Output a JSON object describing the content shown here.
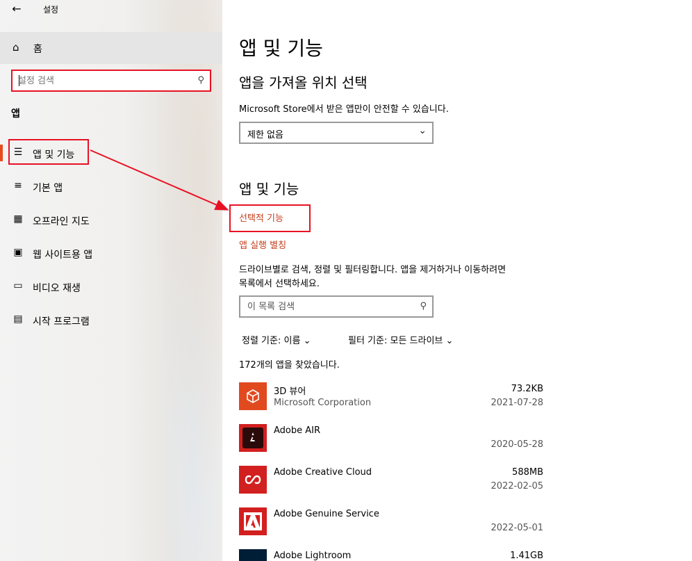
{
  "window": {
    "title": "설정"
  },
  "sidebar": {
    "home_label": "홈",
    "search_placeholder": "설정 검색",
    "section_label": "앱",
    "items": [
      {
        "label": "앱 및 기능"
      },
      {
        "label": "기본 앱"
      },
      {
        "label": "오프라인 지도"
      },
      {
        "label": "웹 사이트용 앱"
      },
      {
        "label": "비디오 재생"
      },
      {
        "label": "시작 프로그램"
      }
    ]
  },
  "main": {
    "page_title": "앱 및 기능",
    "source_heading": "앱을 가져올 위치 선택",
    "source_desc": "Microsoft Store에서 받은 앱만이 안전할 수 있습니다.",
    "source_value": "제한 없음",
    "apps_heading": "앱 및 기능",
    "optional_features_link": "선택적 기능",
    "app_alias_link": "앱 실행 별칭",
    "list_desc_line1": "드라이브별로 검색, 정렬 및 필터링합니다. 앱을 제거하거나 이동하려면",
    "list_desc_line2": "목록에서 선택하세요.",
    "list_search_placeholder": "이 목록 검색",
    "sort_label": "정렬 기준:",
    "sort_value": "이름",
    "filter_label": "필터 기준:",
    "filter_value": "모든 드라이브",
    "count_text": "172개의 앱을 찾았습니다.",
    "apps": [
      {
        "name": "3D 뷰어",
        "publisher": "Microsoft Corporation",
        "size": "73.2KB",
        "date": "2021-07-28"
      },
      {
        "name": "Adobe AIR",
        "publisher": "",
        "size": "",
        "date": "2020-05-28"
      },
      {
        "name": "Adobe Creative Cloud",
        "publisher": "",
        "size": "588MB",
        "date": "2022-02-05"
      },
      {
        "name": "Adobe Genuine Service",
        "publisher": "",
        "size": "",
        "date": "2022-05-01"
      },
      {
        "name": "Adobe Lightroom",
        "publisher": "",
        "size": "1.41GB",
        "date": ""
      }
    ]
  },
  "colors": {
    "accent": "#e74c1c",
    "annotation_red": "#e81123",
    "link": "#c43e1c",
    "app_icon_orange": "#e14a1f",
    "app_icon_red": "#d21f1f",
    "lightroom_blue": "#001e36"
  }
}
